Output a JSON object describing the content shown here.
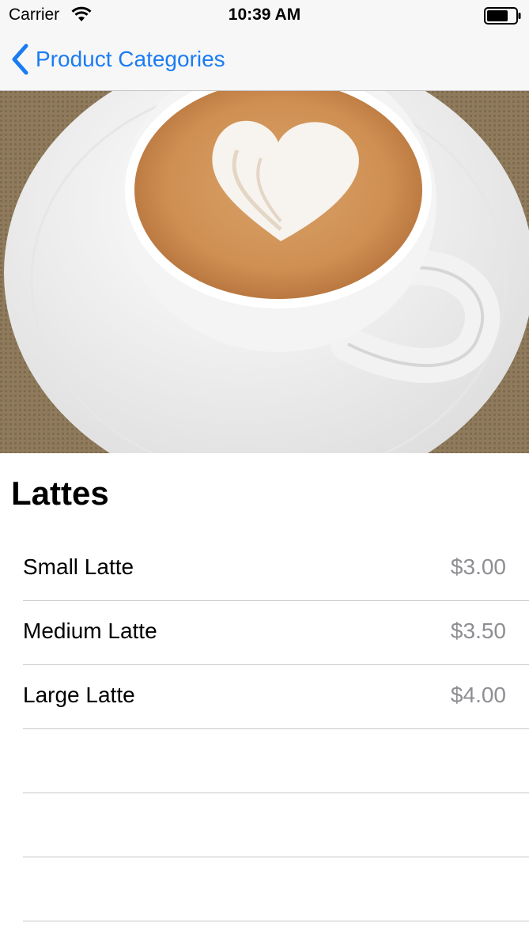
{
  "status_bar": {
    "carrier": "Carrier",
    "time": "10:39 AM",
    "icons": [
      "wifi-icon",
      "battery-icon"
    ]
  },
  "nav": {
    "back_label": "Product Categories",
    "icon": "chevron-left-icon",
    "accent_color": "#1a7cf2"
  },
  "hero": {
    "image": "latte-art-cup-photo"
  },
  "category": {
    "title": "Lattes"
  },
  "products": [
    {
      "name": "Small Latte",
      "price": "$3.00"
    },
    {
      "name": "Medium Latte",
      "price": "$3.50"
    },
    {
      "name": "Large Latte",
      "price": "$4.00"
    }
  ],
  "colors": {
    "price_text": "#8e8e93",
    "separator": "#c8c8cc",
    "bar_background": "#f7f7f7"
  }
}
